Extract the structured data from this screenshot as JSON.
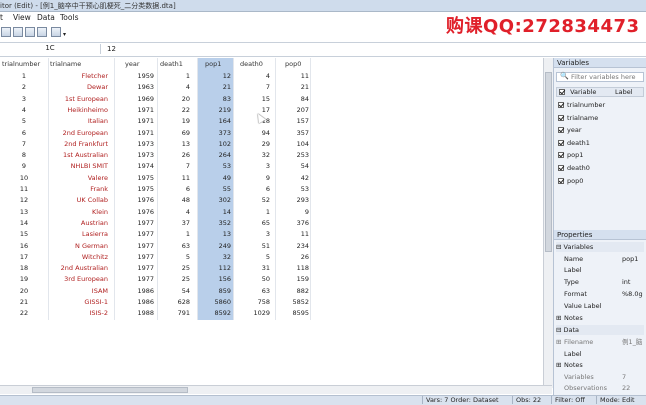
{
  "window": {
    "title": "itor (Edit) - [例1_脑卒中干预心肌梗死_二分类数据.dta]"
  },
  "watermark": "购课QQ:272834473",
  "menu": [
    "t",
    "View",
    "Data",
    "Tools"
  ],
  "command": {
    "cell_ref": "1C",
    "value": "12"
  },
  "grid": {
    "columns": [
      "trialnumber",
      "trialname",
      "year",
      "death1",
      "pop1",
      "death0",
      "pop0"
    ],
    "rows": [
      [
        "1",
        "Fletcher",
        "1959",
        "1",
        "12",
        "4",
        "11"
      ],
      [
        "2",
        "Dewar",
        "1963",
        "4",
        "21",
        "7",
        "21"
      ],
      [
        "3",
        "1st European",
        "1969",
        "20",
        "83",
        "15",
        "84"
      ],
      [
        "4",
        "Heikinheimo",
        "1971",
        "22",
        "219",
        "17",
        "207"
      ],
      [
        "5",
        "Italian",
        "1971",
        "19",
        "164",
        "18",
        "157"
      ],
      [
        "6",
        "2nd European",
        "1971",
        "69",
        "373",
        "94",
        "357"
      ],
      [
        "7",
        "2nd Frankfurt",
        "1973",
        "13",
        "102",
        "29",
        "104"
      ],
      [
        "8",
        "1st Australian",
        "1973",
        "26",
        "264",
        "32",
        "253"
      ],
      [
        "9",
        "NHLBI SMIT",
        "1974",
        "7",
        "53",
        "3",
        "54"
      ],
      [
        "10",
        "Valere",
        "1975",
        "11",
        "49",
        "9",
        "42"
      ],
      [
        "11",
        "Frank",
        "1975",
        "6",
        "55",
        "6",
        "53"
      ],
      [
        "12",
        "UK Collab",
        "1976",
        "48",
        "302",
        "52",
        "293"
      ],
      [
        "13",
        "Klein",
        "1976",
        "4",
        "14",
        "1",
        "9"
      ],
      [
        "14",
        "Austrian",
        "1977",
        "37",
        "352",
        "65",
        "376"
      ],
      [
        "15",
        "Lasierra",
        "1977",
        "1",
        "13",
        "3",
        "11"
      ],
      [
        "16",
        "N German",
        "1977",
        "63",
        "249",
        "51",
        "234"
      ],
      [
        "17",
        "Witchitz",
        "1977",
        "5",
        "32",
        "5",
        "26"
      ],
      [
        "18",
        "2nd Australian",
        "1977",
        "25",
        "112",
        "31",
        "118"
      ],
      [
        "19",
        "3rd European",
        "1977",
        "25",
        "156",
        "50",
        "159"
      ],
      [
        "20",
        "ISAM",
        "1986",
        "54",
        "859",
        "63",
        "882"
      ],
      [
        "21",
        "GISSI-1",
        "1986",
        "628",
        "5860",
        "758",
        "5852"
      ],
      [
        "22",
        "ISIS-2",
        "1988",
        "791",
        "8592",
        "1029",
        "8595"
      ]
    ]
  },
  "variables_panel": {
    "title": "Variables",
    "filter_placeholder": "Filter variables here",
    "col_variable": "Variable",
    "col_label": "Label",
    "items": [
      "trialnumber",
      "trialname",
      "year",
      "death1",
      "pop1",
      "death0",
      "pop0"
    ]
  },
  "properties_panel": {
    "title": "Properties",
    "sec_variables": "Variables",
    "name_key": "Name",
    "name_val": "pop1",
    "label_key": "Label",
    "type_key": "Type",
    "type_val": "int",
    "format_key": "Format",
    "format_val": "%8.0g",
    "value_label_key": "Value Label",
    "notes_key": "Notes",
    "sec_data": "Data",
    "filename_key": "Filename",
    "filename_val": "例1_脑",
    "data_label_key": "Label",
    "data_notes_key": "Notes",
    "variables_key": "Variables",
    "variables_val": "7",
    "observations_key": "Observations",
    "observations_val": "22"
  },
  "status": {
    "vars": "Vars: 7  Order: Dataset",
    "obs": "Obs: 22",
    "filter": "Filter: Off",
    "mode": "Mode: Edit"
  }
}
